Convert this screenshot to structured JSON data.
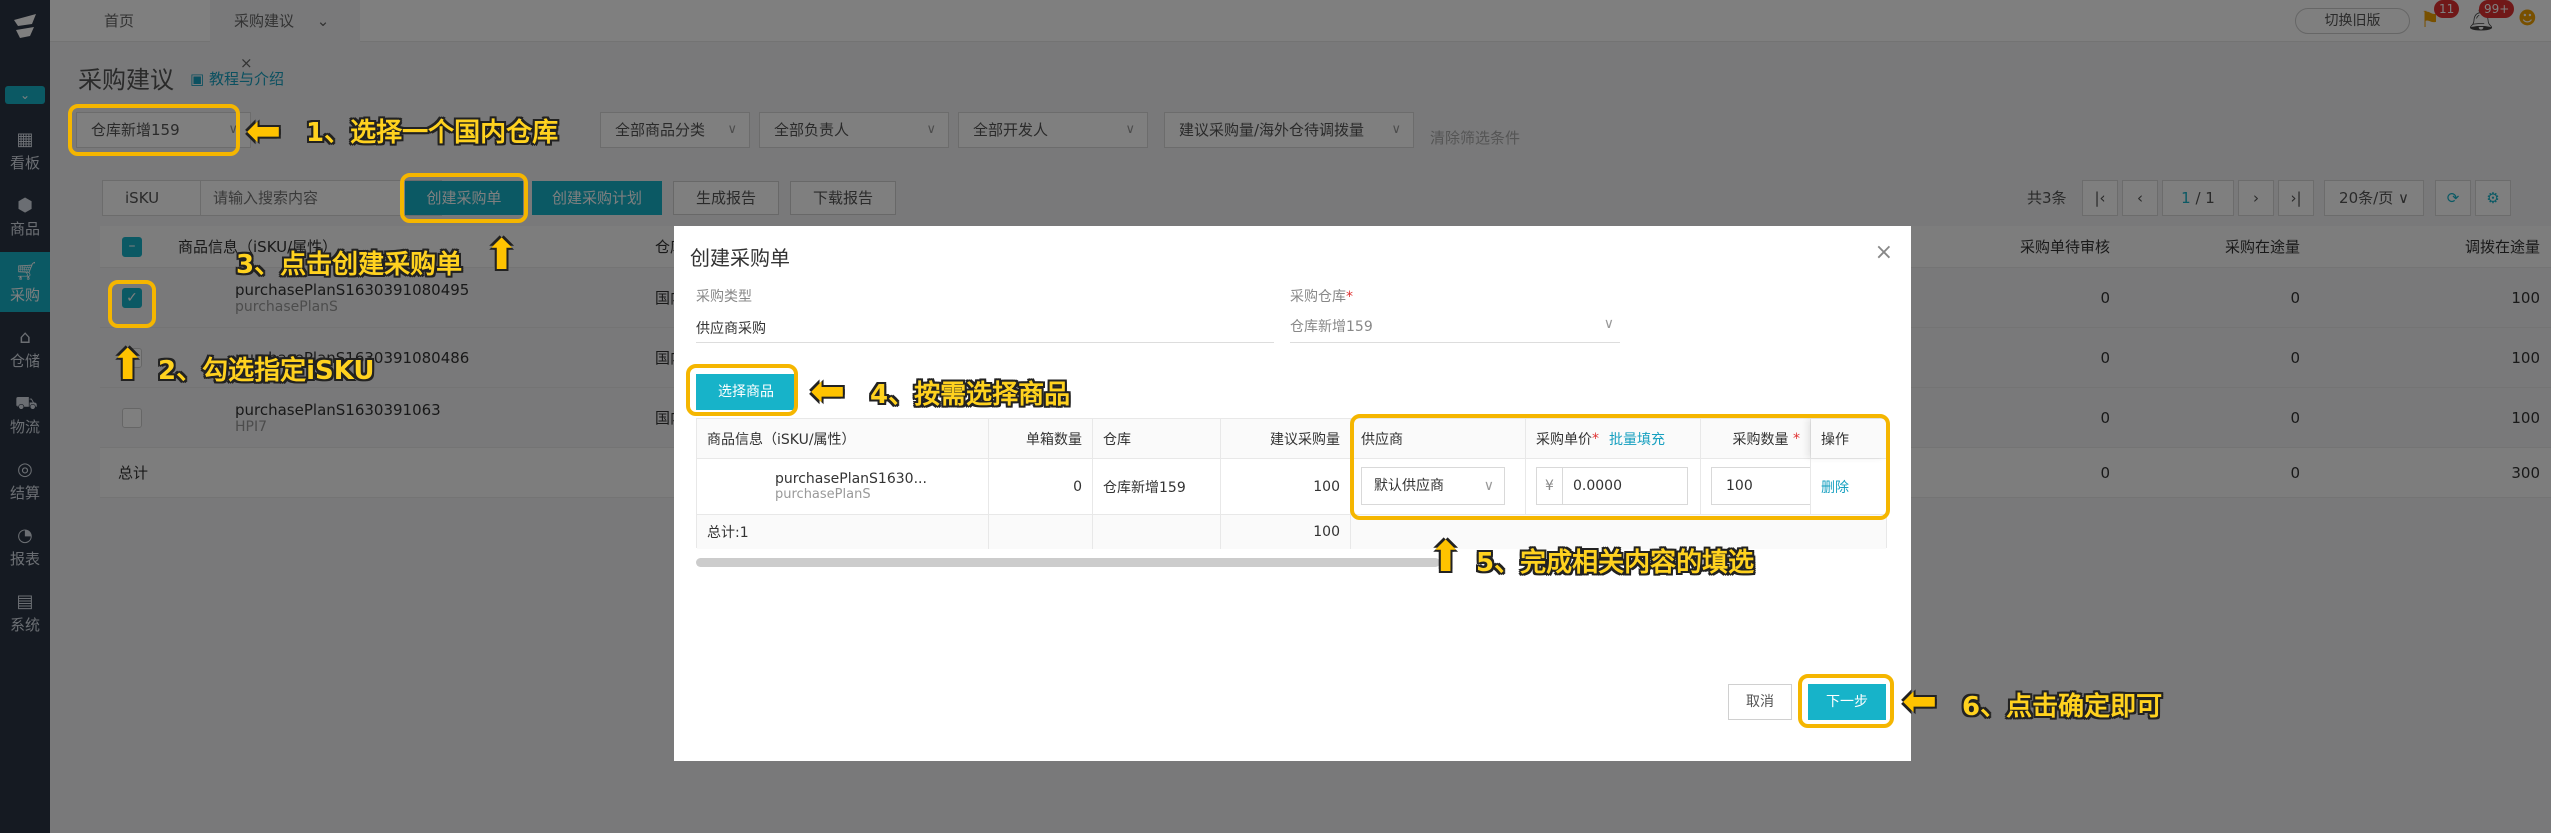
{
  "header": {
    "tab_home": "首页",
    "tab_purchase": "采购建议",
    "old_version": "切换旧版",
    "badge_flag": "11",
    "badge_bell": "99+"
  },
  "sidebar": {
    "items": [
      {
        "label": "看板",
        "icon": "dashboard-icon"
      },
      {
        "label": "商品",
        "icon": "cube-icon"
      },
      {
        "label": "采购",
        "icon": "cart-icon"
      },
      {
        "label": "仓储",
        "icon": "warehouse-icon"
      },
      {
        "label": "物流",
        "icon": "truck-icon"
      },
      {
        "label": "结算",
        "icon": "money-icon"
      },
      {
        "label": "报表",
        "icon": "chart-icon"
      },
      {
        "label": "系统",
        "icon": "settings-icon"
      }
    ]
  },
  "page": {
    "title": "采购建议",
    "tutorial": "教程与介绍"
  },
  "filters": {
    "warehouse": "仓库新增159",
    "category": "全部商品分类",
    "owner": "全部负责人",
    "developer": "全部开发人",
    "suggest": "建议采购量/海外仓待调拨量",
    "clear": "清除筛选条件"
  },
  "toolbar": {
    "sku_select": "iSKU",
    "search_placeholder": "请输入搜索内容",
    "create_order": "创建采购单",
    "create_plan": "创建采购计划",
    "gen_report": "生成报告",
    "download_report": "下载报告",
    "total": "共3条",
    "page_current": "1",
    "page_total": "/ 1",
    "page_size": "20条/页"
  },
  "table": {
    "headers": {
      "product": "商品信息（iSKU/属性）",
      "warehouse_type": "仓库类型",
      "pending": "采购单待审核",
      "in_transit": "采购在途量",
      "transfer": "调拨在途量"
    },
    "rows": [
      {
        "sku": "purchasePlanS1630391080495",
        "attr": "purchasePlanS",
        "type": "国内实体仓",
        "pending": "0",
        "in_transit": "0",
        "transfer": "100"
      },
      {
        "sku": "purchasePlanS1630391080486",
        "attr": "",
        "type": "国内实体仓",
        "pending": "0",
        "in_transit": "0",
        "transfer": "100"
      },
      {
        "sku": "purchasePlanS1630391063",
        "attr": "HPI7",
        "type": "国内实体仓",
        "pending": "0",
        "in_transit": "0",
        "transfer": "100"
      }
    ],
    "total_label": "总计",
    "total": {
      "pending": "0",
      "in_transit": "0",
      "transfer": "300"
    }
  },
  "modal": {
    "title": "创建采购单",
    "type_label": "采购类型",
    "type_value": "供应商采购",
    "wh_label": "采购仓库",
    "wh_value": "仓库新增159",
    "select_goods": "选择商品",
    "headers": {
      "product": "商品信息（iSKU/属性）",
      "box_qty": "单箱数量",
      "warehouse": "仓库",
      "suggest_qty": "建议采购量",
      "supplier": "供应商",
      "unit_price": "采购单价",
      "batch_fill": "批量填充",
      "qty": "采购数量",
      "action": "操作"
    },
    "row": {
      "sku": "purchasePlanS1630...",
      "attr": "purchasePlanS",
      "box_qty": "0",
      "warehouse": "仓库新增159",
      "suggest_qty": "100",
      "supplier": "默认供应商",
      "currency": "¥",
      "price": "0.0000",
      "qty": "100",
      "delete": "删除"
    },
    "total_label": "总计:1",
    "total_suggest": "100",
    "cancel": "取消",
    "next": "下一步"
  },
  "annotations": {
    "step1": "1、选择一个国内仓库",
    "step2": "2、勾选指定iSKU",
    "step3": "3、点击创建采购单",
    "step4": "4、按需选择商品",
    "step5": "5、完成相关内容的填选",
    "step6": "6、点击确定即可"
  },
  "colors": {
    "primary": "#17b3c9",
    "sidebar": "#2a3544",
    "highlight": "#f5b600"
  }
}
